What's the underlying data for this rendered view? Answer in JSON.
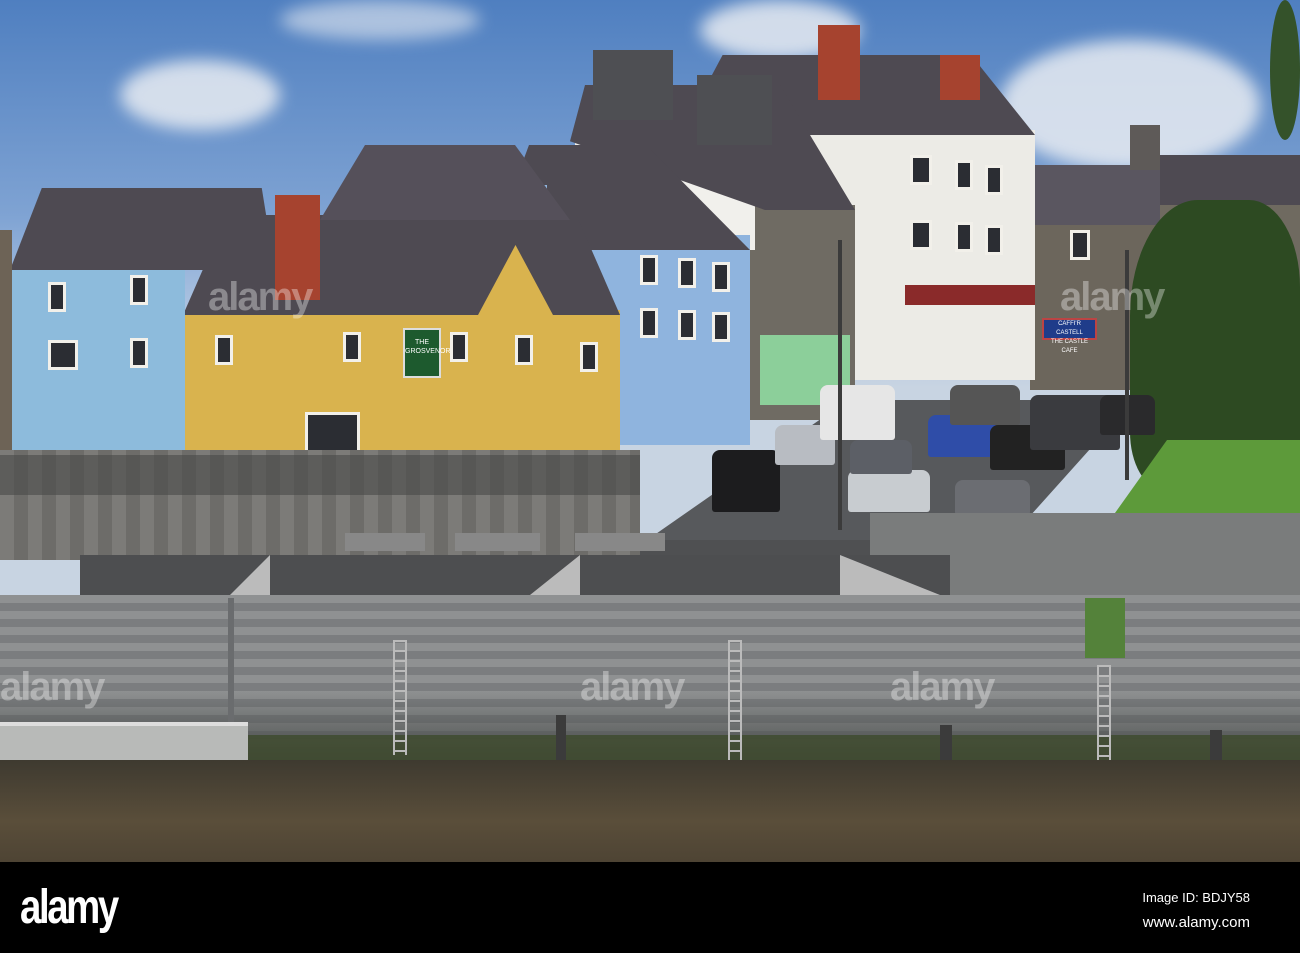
{
  "photo": {
    "signs": {
      "pub": "THE GROSVENOR",
      "cafe_line1": "CAFFI'R CASTELL",
      "cafe_line2": "THE CASTLE CAFE"
    },
    "watermark": "alamy"
  },
  "footer": {
    "logo": "alamy",
    "image_id": "Image ID: BDJY58",
    "url": "www.alamy.com"
  },
  "colors": {
    "sky": "#4f7fc0",
    "water": "#4a4032",
    "wall": "#8a8c8e",
    "yellow_house": "#d9b34e",
    "blue_house": "#8fb4de"
  }
}
